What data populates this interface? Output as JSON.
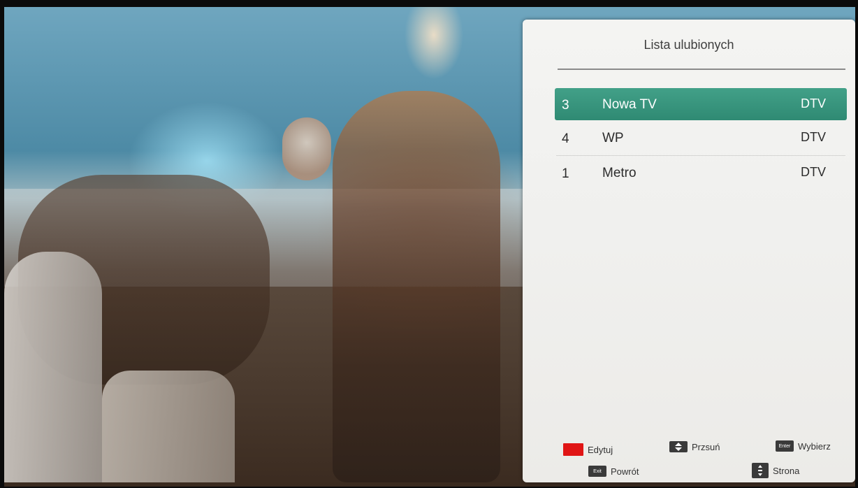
{
  "panel": {
    "title": "Lista ulubionych",
    "channels": [
      {
        "number": "3",
        "name": "Nowa TV",
        "type": "DTV",
        "selected": true
      },
      {
        "number": "4",
        "name": "WP",
        "type": "DTV",
        "selected": false
      },
      {
        "number": "1",
        "name": "Metro",
        "type": "DTV",
        "selected": false
      }
    ],
    "colors": {
      "selected": "#3a9a80",
      "red_key": "#e01515"
    }
  },
  "legend": {
    "edit": {
      "label": "Edytuj",
      "icon": "red-key-icon"
    },
    "move": {
      "label": "Przsuń",
      "icon": "up-down-arrows-icon"
    },
    "select": {
      "label": "Wybierz",
      "key": "Enter",
      "icon": "enter-key-icon"
    },
    "back": {
      "label": "Powrót",
      "key": "Exit",
      "icon": "exit-key-icon"
    },
    "page": {
      "label": "Strona",
      "icon": "ch-page-key-icon"
    }
  }
}
